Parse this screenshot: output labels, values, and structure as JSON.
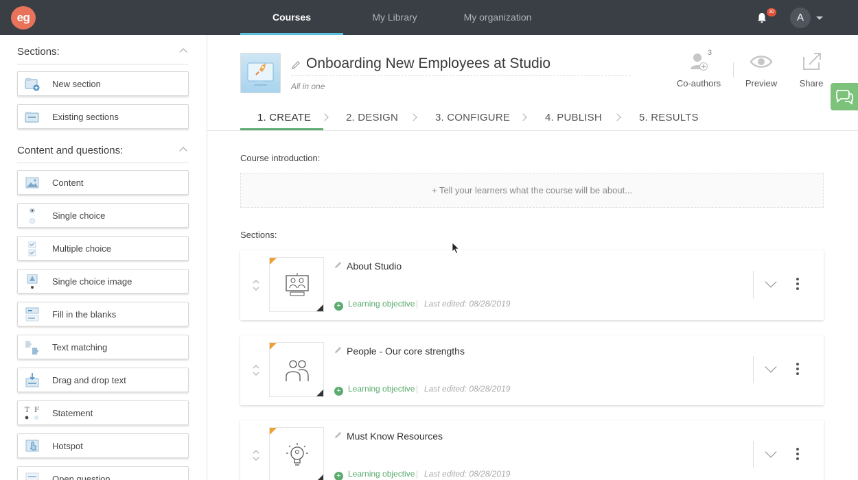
{
  "app": {
    "logo_text": "eg"
  },
  "topnav": {
    "tabs": [
      {
        "label": "Courses",
        "active": true
      },
      {
        "label": "My Library",
        "active": false
      },
      {
        "label": "My organization",
        "active": false
      }
    ],
    "notifications_count": "30",
    "avatar_initial": "A"
  },
  "sidebar": {
    "sections_heading": "Sections:",
    "section_items": [
      {
        "label": "New section",
        "icon": "new-section-icon"
      },
      {
        "label": "Existing sections",
        "icon": "existing-sections-icon"
      }
    ],
    "content_heading": "Content and questions:",
    "content_items": [
      {
        "label": "Content",
        "icon": "content-icon"
      },
      {
        "label": "Single choice",
        "icon": "single-choice-icon"
      },
      {
        "label": "Multiple choice",
        "icon": "multiple-choice-icon"
      },
      {
        "label": "Single choice image",
        "icon": "single-choice-image-icon"
      },
      {
        "label": "Fill in the blanks",
        "icon": "fill-blanks-icon"
      },
      {
        "label": "Text matching",
        "icon": "text-matching-icon"
      },
      {
        "label": "Drag and drop text",
        "icon": "drag-drop-text-icon"
      },
      {
        "label": "Statement",
        "icon": "statement-icon"
      },
      {
        "label": "Hotspot",
        "icon": "hotspot-icon"
      },
      {
        "label": "Open question",
        "icon": "open-question-icon"
      }
    ]
  },
  "course": {
    "title": "Onboarding New Employees at Studio",
    "subtitle": "All in one",
    "actions": {
      "coauthors_label": "Co-authors",
      "coauthors_count": "3",
      "preview_label": "Preview",
      "share_label": "Share"
    }
  },
  "steps": [
    {
      "label": "1. CREATE",
      "active": true
    },
    {
      "label": "2. DESIGN",
      "active": false
    },
    {
      "label": "3. CONFIGURE",
      "active": false
    },
    {
      "label": "4. PUBLISH",
      "active": false
    },
    {
      "label": "5. RESULTS",
      "active": false
    }
  ],
  "intro": {
    "heading": "Course introduction:",
    "placeholder": "+ Tell your learners what the course will be about..."
  },
  "sections": {
    "heading": "Sections:",
    "items": [
      {
        "title": "About Studio",
        "objective": "Learning objective",
        "edited": "Last edited: 08/28/2019",
        "icon": "video-call-icon"
      },
      {
        "title": "People - Our core strengths",
        "objective": "Learning objective",
        "edited": "Last edited: 08/28/2019",
        "icon": "people-icon"
      },
      {
        "title": "Must Know Resources",
        "objective": "Learning objective",
        "edited": "Last edited: 08/28/2019",
        "icon": "lightbulb-icon"
      }
    ]
  },
  "colors": {
    "topbar": "#3a3f46",
    "accent_blue": "#5bc0de",
    "accent_green": "#5aab6e",
    "logo": "#e8735a",
    "chat": "#7dc27a"
  }
}
